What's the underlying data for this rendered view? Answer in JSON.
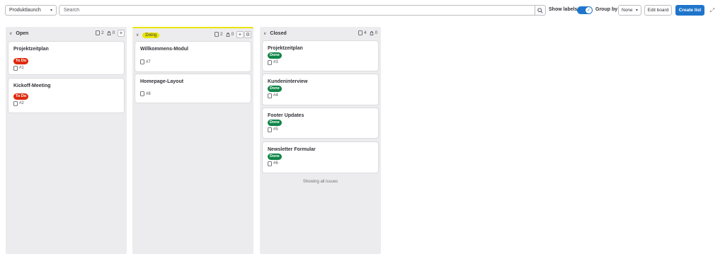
{
  "toolbar": {
    "board_name": "Produktlaunch",
    "search_placeholder": "Search",
    "show_labels_label": "Show labels",
    "show_labels_on": true,
    "group_by_label": "Group by",
    "group_by_value": "None",
    "edit_board_label": "Edit board",
    "create_list_label": "Create list"
  },
  "lists": [
    {
      "title": "Open",
      "issue_count": "2",
      "weight": "0",
      "cards": [
        {
          "title": "Projektzeitplan",
          "label": "To Do",
          "ref": "#1"
        },
        {
          "title": "Kickoff-Meeting",
          "label": "To Do",
          "ref": "#2"
        }
      ]
    },
    {
      "title": "Doing",
      "issue_count": "2",
      "weight": "0",
      "cards": [
        {
          "title": "Willkommens-Modul",
          "ref": "#7"
        },
        {
          "title": "Homepage-Layout",
          "ref": "#8"
        }
      ]
    },
    {
      "title": "Closed",
      "issue_count": "4",
      "weight": "0",
      "cards": [
        {
          "title": "Projektzeitplan",
          "label": "Done",
          "ref": "#3"
        },
        {
          "title": "Kundeninterview",
          "label": "Done",
          "ref": "#4"
        },
        {
          "title": "Footer Updates",
          "label": "Done",
          "ref": "#5"
        },
        {
          "title": "Newsletter Formular",
          "label": "Done",
          "ref": "#6"
        }
      ],
      "footer": "Showing all issues"
    }
  ],
  "colors": {
    "primary": "#1f75cb",
    "todo": "#dd2b0e",
    "done": "#108548",
    "doing": "#e9e50a",
    "list_bg": "#ececef"
  }
}
